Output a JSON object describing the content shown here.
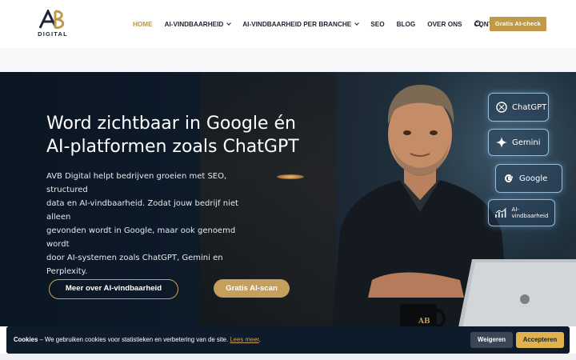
{
  "brand": {
    "logo_text": "DIGITAL",
    "accent": "#c09a4a",
    "dark": "#0e1b2b"
  },
  "nav": {
    "items": [
      {
        "label": "HOME",
        "active": true
      },
      {
        "label": "AI-VINDBAARHEID",
        "dropdown": true
      },
      {
        "label": "AI-VINDBAARHEID PER BRANCHE",
        "dropdown": true
      },
      {
        "label": "SEO"
      },
      {
        "label": "BLOG"
      },
      {
        "label": "OVER ONS"
      },
      {
        "label": "CONTACT"
      }
    ],
    "search_icon": "search-icon",
    "cta_label": "Gratis AI-check"
  },
  "hero": {
    "title_line1": "Word zichtbaar in Google én",
    "title_line2": "AI-platformen zoals ChatGPT",
    "text_line1": "AVB Digital helpt bedrijven groeien met SEO, structured",
    "text_line2": "data en AI-vindbaarheid. Zodat jouw bedrijf niet alleen",
    "text_line3": "gevonden wordt in Google, maar ook genoemd wordt",
    "text_line4": "door AI-systemen zoals ChatGPT, Gemini en Perplexity.",
    "btn_secondary": "Meer over AI-vindbaarheid",
    "btn_primary": "Gratis AI-scan",
    "platforms": [
      "ChatGPT",
      "Gemini",
      "Google",
      "AI-vindbaarheid"
    ],
    "mug_text": "AB"
  },
  "cookie": {
    "title": "Cookies",
    "text": " – We gebruiken cookies voor statistieken en verbetering van de site. ",
    "link": "Lees meer",
    "end": ".",
    "decline": "Weigeren",
    "accept": "Accepteren"
  }
}
